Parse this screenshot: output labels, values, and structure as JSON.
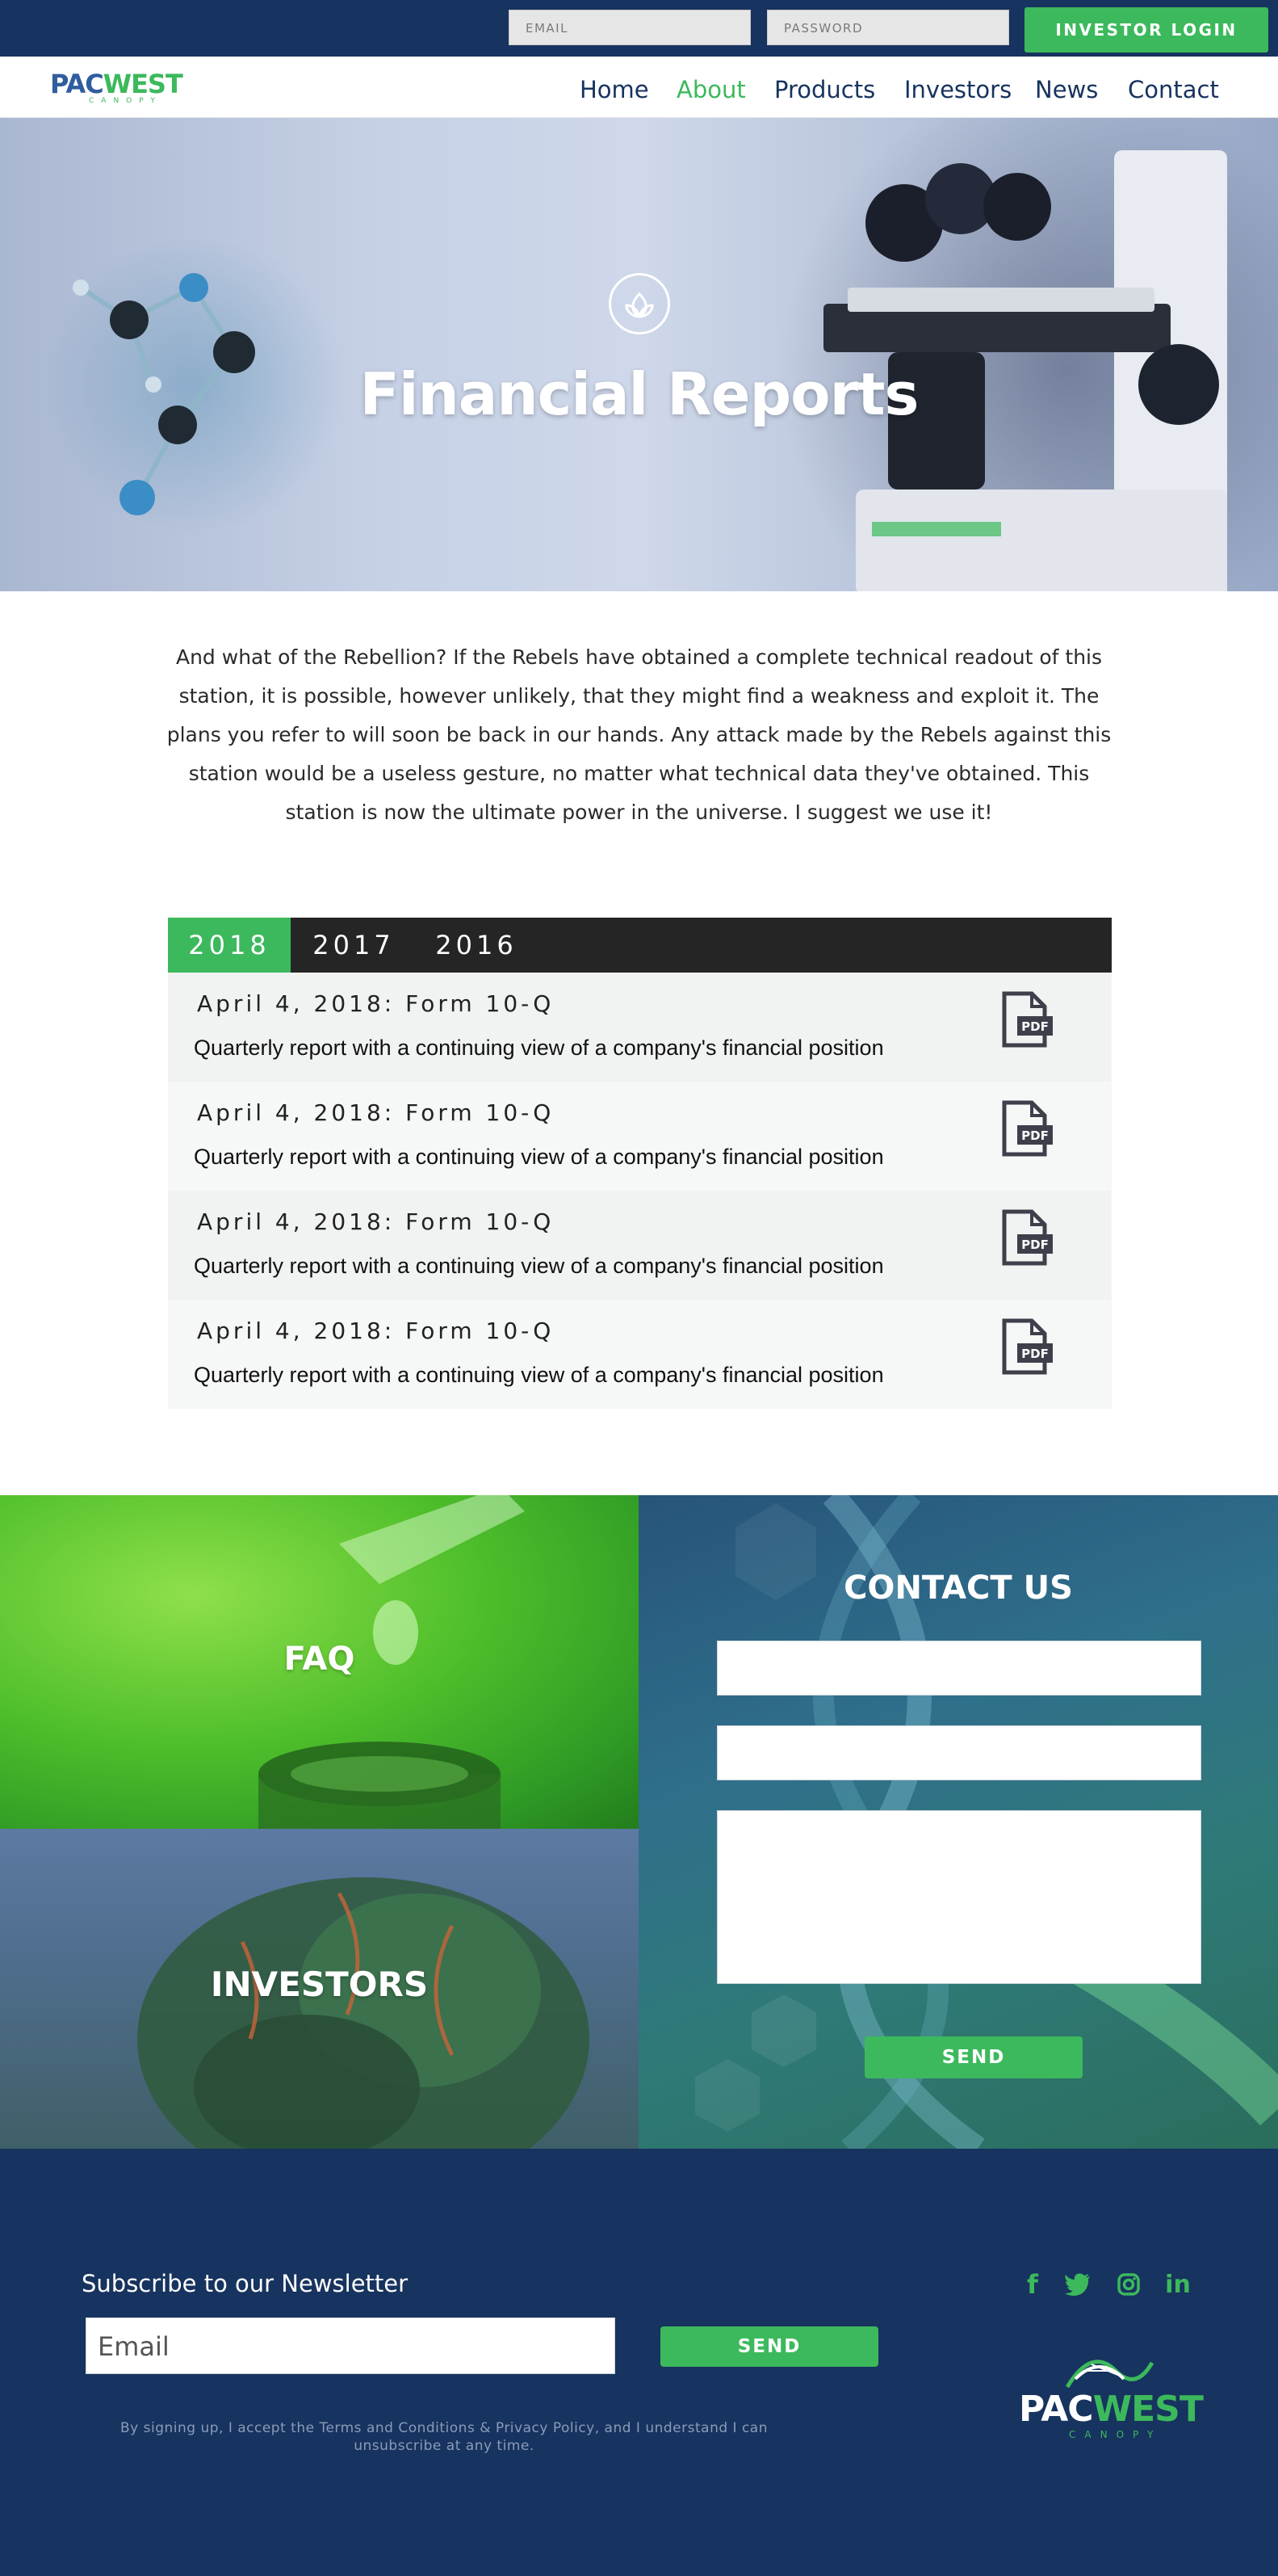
{
  "topbar": {
    "email_placeholder": "EMAIL",
    "password_placeholder": "PASSWORD",
    "login_label": "INVESTOR LOGIN"
  },
  "brand": {
    "name_part1": "PAC",
    "name_part2": "WEST",
    "tagline": "CANOPY"
  },
  "nav": {
    "items": [
      {
        "label": "Home",
        "active": false
      },
      {
        "label": "About",
        "active": true
      },
      {
        "label": "Products",
        "active": false
      },
      {
        "label": "Investors",
        "active": false
      },
      {
        "label": "News",
        "active": false
      },
      {
        "label": "Contact",
        "active": false
      }
    ]
  },
  "hero": {
    "icon": "leaf-icon",
    "title": "Financial Reports"
  },
  "intro": {
    "text": "And what of the Rebellion? If the Rebels have obtained a complete technical readout of this station, it is possible, however unlikely, that they might find a weakness and exploit it. The plans you refer to will soon be back in our hands. Any attack made by the Rebels against this station would be a useless gesture, no matter what technical data they've obtained. This station is now the ultimate power in the universe. I suggest we use it!"
  },
  "reports": {
    "years": [
      {
        "label": "2018",
        "active": true
      },
      {
        "label": "2017",
        "active": false
      },
      {
        "label": "2016",
        "active": false
      }
    ],
    "items": [
      {
        "title": "April 4, 2018: Form 10-Q",
        "description": "Quarterly report with a continuing view of a company's financial position",
        "icon": "pdf-icon",
        "icon_text": "PDF"
      },
      {
        "title": "April 4, 2018: Form 10-Q",
        "description": "Quarterly report with a continuing view of a company's financial position",
        "icon": "pdf-icon",
        "icon_text": "PDF"
      },
      {
        "title": "April 4, 2018: Form 10-Q",
        "description": "Quarterly report with a continuing view of a company's financial position",
        "icon": "pdf-icon",
        "icon_text": "PDF"
      },
      {
        "title": "April 4, 2018: Form 10-Q",
        "description": "Quarterly report with a continuing view of a company's financial position",
        "icon": "pdf-icon",
        "icon_text": "PDF"
      }
    ]
  },
  "tiles": {
    "faq_label": "FAQ",
    "investors_label": "INVESTORS"
  },
  "contact": {
    "title": "CONTACT US",
    "name_value": "",
    "email_value": "",
    "message_value": "",
    "send_label": "SEND"
  },
  "footer": {
    "newsletter_title": "Subscribe to our Newsletter",
    "email_placeholder": "Email",
    "send_label": "SEND",
    "disclaimer": "By signing up, I accept the Terms and Conditions & Privacy Policy, and I understand I can unsubscribe at any time.",
    "social": [
      {
        "icon": "facebook-icon",
        "glyph": "f"
      },
      {
        "icon": "twitter-icon",
        "glyph": "t"
      },
      {
        "icon": "instagram-icon",
        "glyph": "ig"
      },
      {
        "icon": "linkedin-icon",
        "glyph": "in"
      }
    ]
  },
  "colors": {
    "navy": "#17335f",
    "green": "#3cb95c",
    "tab_bar": "#252525",
    "row_light": "#f1f2f2"
  }
}
